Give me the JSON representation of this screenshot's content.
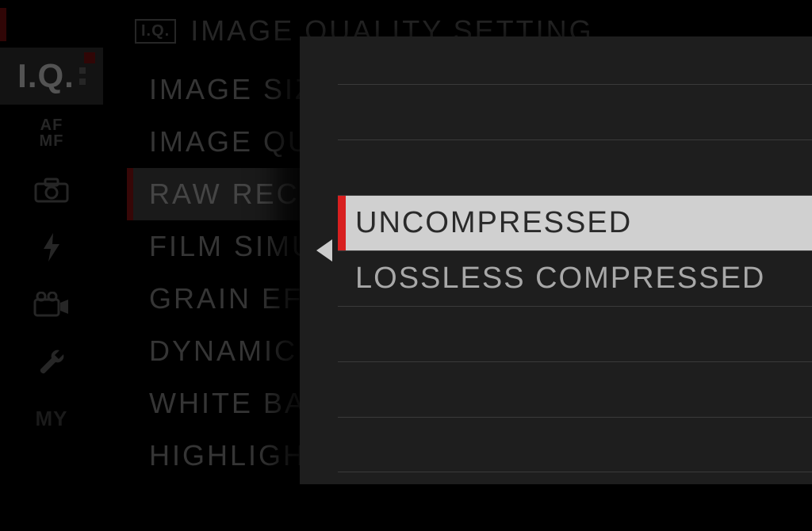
{
  "header": {
    "icon_label": "I.Q.",
    "title": "IMAGE QUALITY SETTING"
  },
  "sidebar": {
    "items": [
      {
        "label": "I.Q.",
        "active": true,
        "type": "iq"
      },
      {
        "label_top": "AF",
        "label_bottom": "MF",
        "type": "afmf"
      },
      {
        "type": "camera"
      },
      {
        "type": "flash"
      },
      {
        "type": "movie"
      },
      {
        "type": "wrench"
      },
      {
        "label": "MY",
        "type": "my"
      }
    ]
  },
  "menu": {
    "items": [
      {
        "label": "IMAGE SIZE",
        "selected": false
      },
      {
        "label": "IMAGE QUALITY",
        "selected": false
      },
      {
        "label": "RAW RECORDING",
        "selected": true
      },
      {
        "label": "FILM SIMULATION",
        "selected": false
      },
      {
        "label": "GRAIN EFFECT",
        "selected": false
      },
      {
        "label": "DYNAMIC RANGE",
        "selected": false
      },
      {
        "label": "WHITE BALANCE",
        "selected": false
      },
      {
        "label": "HIGHLIGHT TONE",
        "selected": false
      }
    ]
  },
  "popup": {
    "options": [
      {
        "label": "UNCOMPRESSED",
        "selected": true
      },
      {
        "label": "LOSSLESS COMPRESSED",
        "selected": false
      }
    ]
  }
}
